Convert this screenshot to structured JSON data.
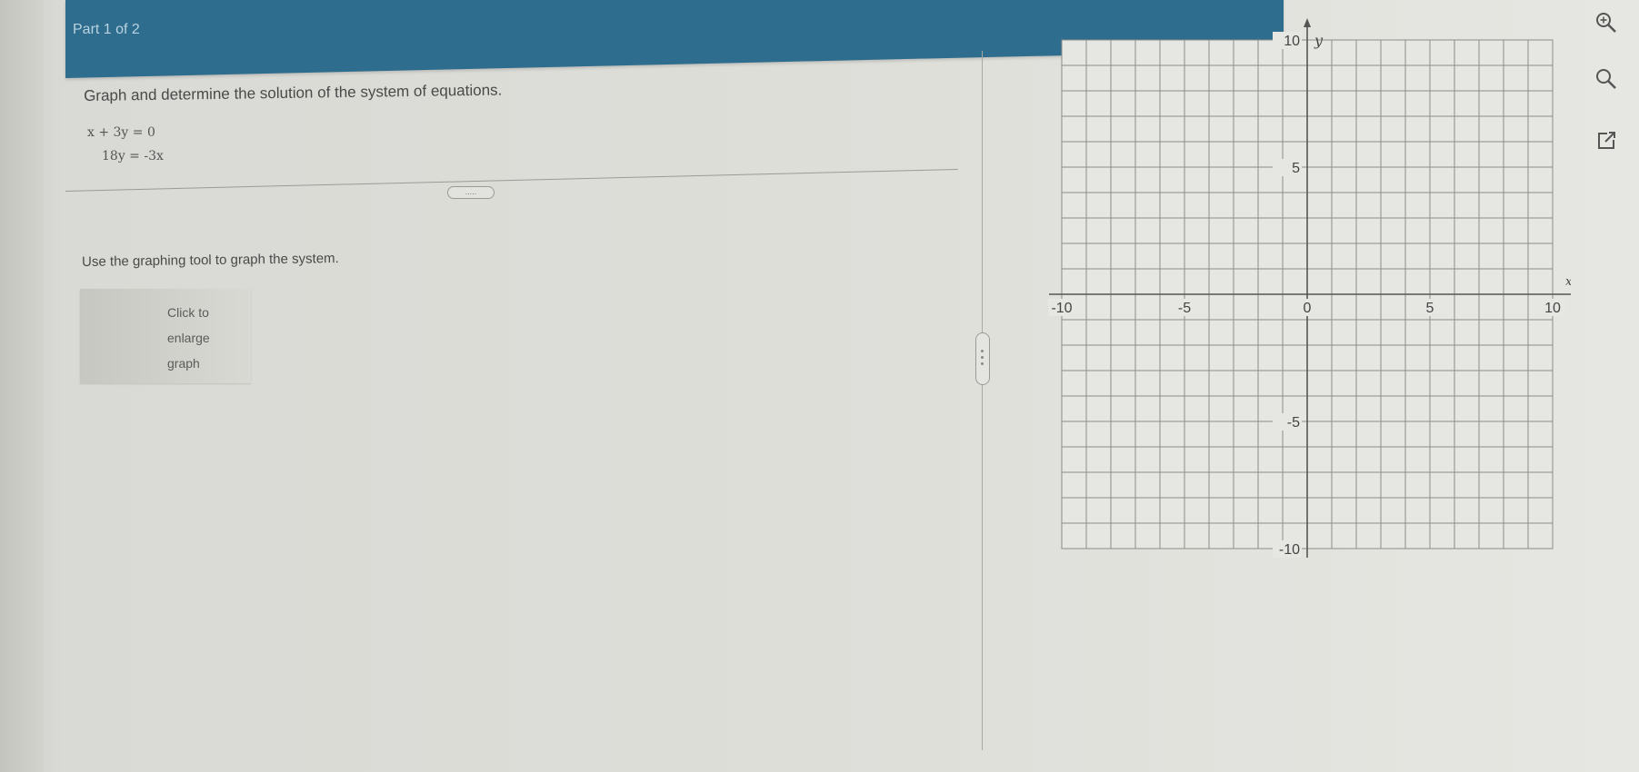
{
  "header": {
    "part_label": "Part 1 of 2"
  },
  "question": {
    "instruction": "Graph and determine the solution of the system of equations.",
    "equations": [
      "x + 3y = 0",
      "18y = -3x"
    ]
  },
  "divider": {
    "handle_label": "....."
  },
  "tool": {
    "instruction": "Use the graphing tool to graph the system.",
    "enlarge_button": [
      "Click to",
      "enlarge",
      "graph"
    ]
  },
  "sidebar_icons": [
    "zoom-in-icon",
    "search-icon",
    "external-link-icon"
  ],
  "colors": {
    "header": "#2f6d8e",
    "grid": "#8c8c88",
    "axes": "#555555"
  },
  "graph": {
    "x_label": "x",
    "y_label": "y",
    "x_range": [
      -10,
      10
    ],
    "y_range": [
      -10,
      10
    ],
    "grid_step": 1,
    "x_tick_labels": [
      {
        "value": -10,
        "text": "-10"
      },
      {
        "value": -5,
        "text": "-5"
      },
      {
        "value": 0,
        "text": "0"
      },
      {
        "value": 5,
        "text": "5"
      },
      {
        "value": 10,
        "text": "10"
      }
    ],
    "y_tick_labels": [
      {
        "value": 10,
        "text": "10"
      },
      {
        "value": 5,
        "text": "5"
      },
      {
        "value": -5,
        "text": "-5"
      },
      {
        "value": -10,
        "text": "-10"
      }
    ]
  }
}
